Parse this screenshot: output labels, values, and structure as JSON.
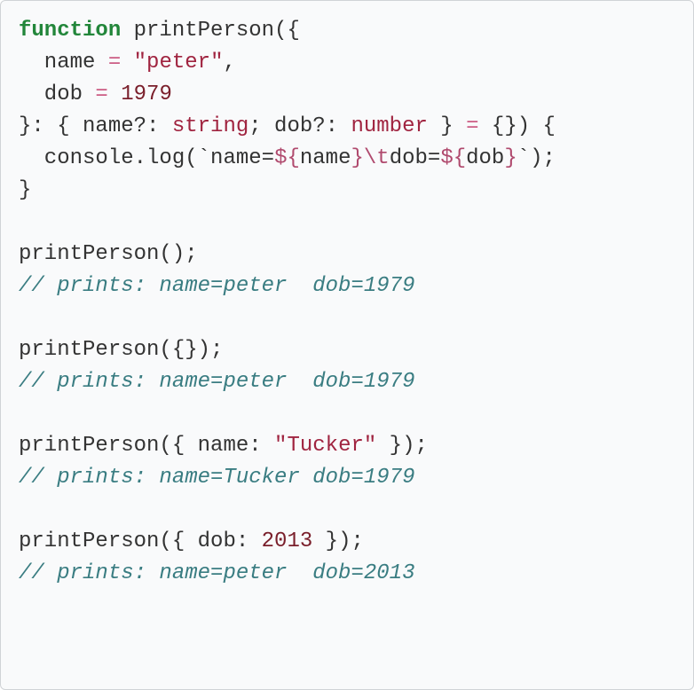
{
  "colors": {
    "background": "#f9fafb",
    "border": "#d0d3d6",
    "keyword": "#22863a",
    "identifier": "#333333",
    "operator": "#cc5c84",
    "string": "#a02440",
    "number": "#7a1f2b",
    "type": "#a02440",
    "comment": "#3a7d82",
    "interpolation": "#b04a6e"
  },
  "t": {
    "l1_function": "function",
    "l1_name": " printPerson",
    "l1_open": "({",
    "l2_indent": "  name ",
    "l2_eq": "= ",
    "l2_q1": "\"",
    "l2_str": "peter",
    "l2_q2": "\"",
    "l2_comma": ",",
    "l3_indent": "  dob ",
    "l3_eq": "= ",
    "l3_num": "1979",
    "l4_a": "}: { name?: ",
    "l4_t1": "string",
    "l4_b": "; dob?: ",
    "l4_t2": "number",
    "l4_c": " } ",
    "l4_eq": "= ",
    "l4_d": "{}) {",
    "l5_a": "  console.log(",
    "l5_tick1": "`",
    "l5_txt1": "name=",
    "l5_i1o": "${",
    "l5_i1v": "name",
    "l5_i1c": "}",
    "l5_esc": "\\t",
    "l5_txt2": "dob=",
    "l5_i2o": "${",
    "l5_i2v": "dob",
    "l5_i2c": "}",
    "l5_tick2": "`",
    "l5_end": ");",
    "l6": "}",
    "l8": "printPerson();",
    "l9": "// prints: name=peter  dob=1979",
    "l11": "printPerson({});",
    "l12": "// prints: name=peter  dob=1979",
    "l14_a": "printPerson({ name: ",
    "l14_q1": "\"",
    "l14_str": "Tucker",
    "l14_q2": "\"",
    "l14_b": " });",
    "l15": "// prints: name=Tucker dob=1979",
    "l17_a": "printPerson({ dob: ",
    "l17_num": "2013",
    "l17_b": " });",
    "l18": "// prints: name=peter  dob=2013"
  }
}
